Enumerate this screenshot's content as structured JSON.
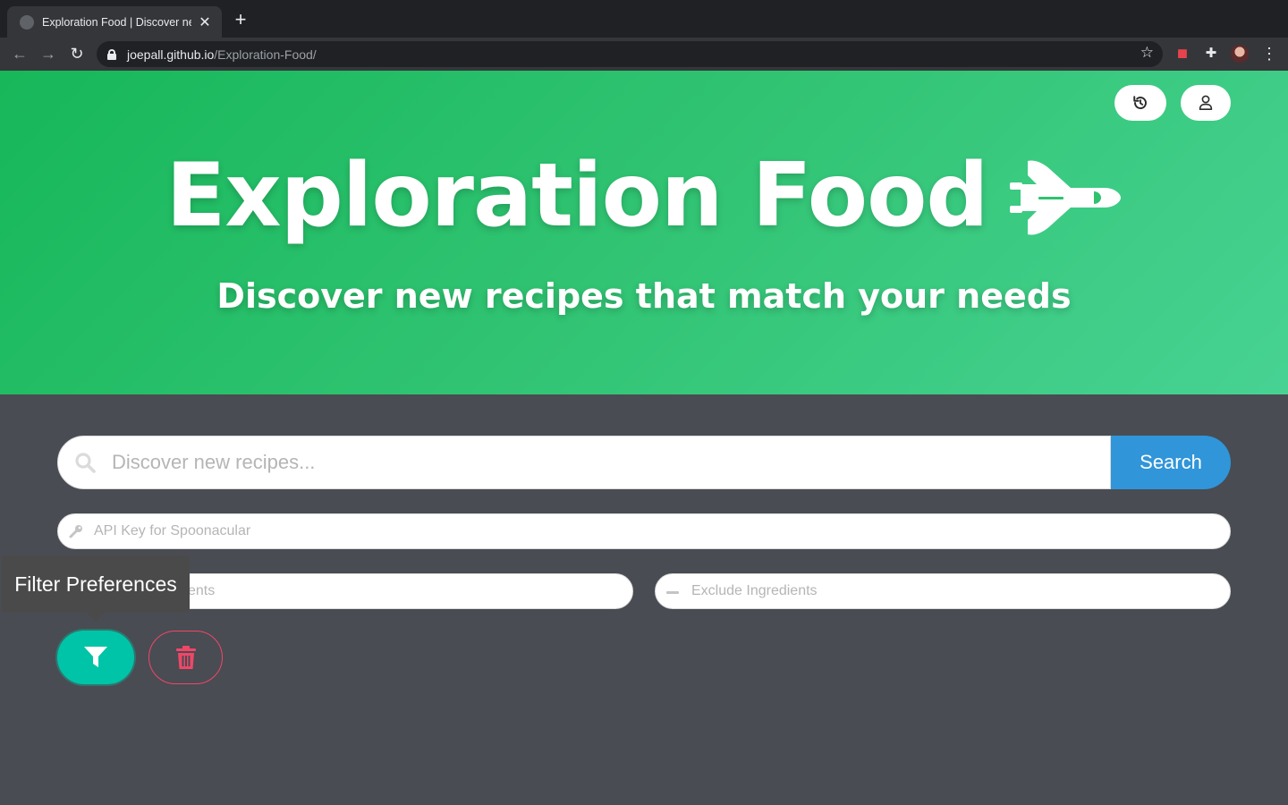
{
  "browser": {
    "tab_title": "Exploration Food | Discover new recipes",
    "tab_close": "✕",
    "new_tab": "+",
    "url_host": "joepall.github.io",
    "url_path": "/Exploration-Food/"
  },
  "header": {
    "history_icon": "history-icon",
    "user_icon": "user-icon",
    "title": "Exploration Food",
    "subtitle": "Discover new recipes that match your needs",
    "logo_icon": "space-shuttle-icon"
  },
  "search": {
    "placeholder": "Discover new recipes...",
    "button_label": "Search"
  },
  "api_key": {
    "placeholder": "API Key for Spoonacular"
  },
  "include": {
    "placeholder": "Include Ingredients"
  },
  "exclude": {
    "placeholder": "Exclude Ingredients"
  },
  "actions": {
    "filter_tooltip": "Filter Preferences",
    "filter_icon": "filter-icon",
    "clear_icon": "trash-icon"
  },
  "colors": {
    "hero_gradient_start": "#17b75a",
    "hero_gradient_end": "#47d293",
    "page_background": "#494c52",
    "search_button": "#3095d9",
    "filter_button": "#00c4a7",
    "clear_button_border": "#f14668"
  }
}
